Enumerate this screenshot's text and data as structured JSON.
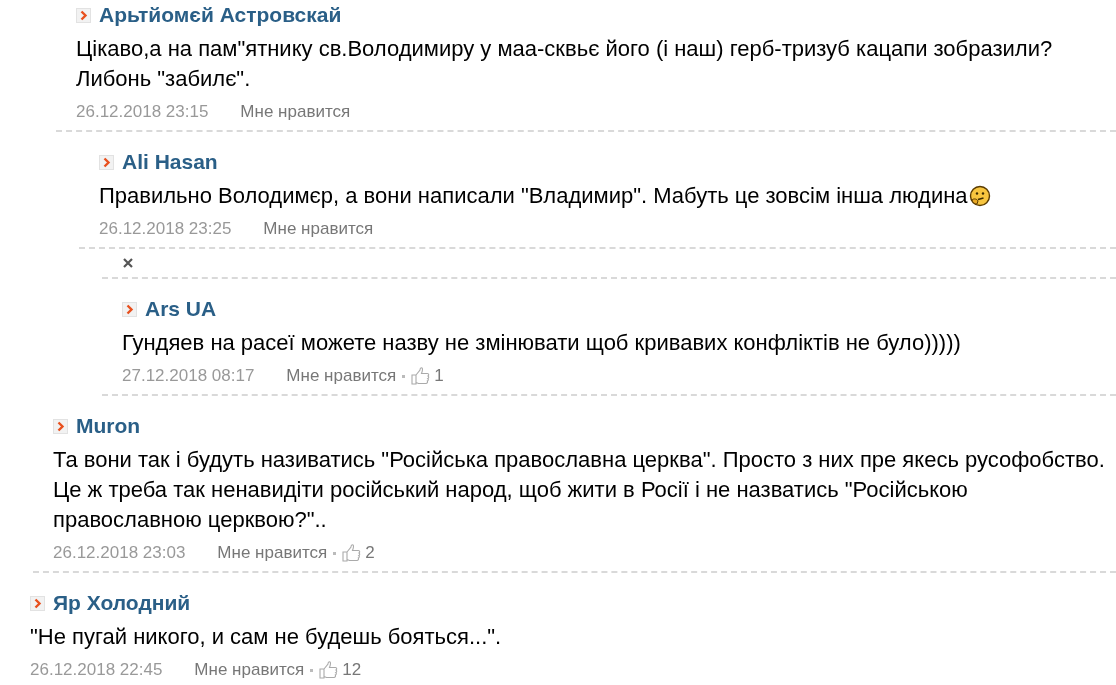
{
  "comments": [
    {
      "kind": "group",
      "children": [
        {
          "kind": "group",
          "children": [
            {
              "kind": "comment",
              "author": "Арьтйомєй Астровскай",
              "text": "Цікаво,а на пам\"ятнику св.Володимиру у маа-сквьє його (і наш) герб-тризуб кацапи зобразили? Либонь \"забилє\".",
              "date": "26.12.2018 23:15",
              "like": "Мне нравится",
              "children": [
                {
                  "kind": "comment",
                  "author": "Ali Hasan",
                  "text": "Правильно Володимєр, а вони написали \"Владимир\". Мабуть це зовсім інша людина",
                  "emoji": true,
                  "date": "26.12.2018 23:25",
                  "like": "Мне нравится",
                  "children": [
                    {
                      "kind": "close"
                    },
                    {
                      "kind": "comment",
                      "author": "Ars UA",
                      "text": "Гундяев на расеї можете назву не змінювати щоб кривавих конфліктів не було)))))",
                      "date": "27.12.2018 08:17",
                      "like": "Мне нравится",
                      "likes": "1"
                    }
                  ]
                }
              ]
            }
          ]
        },
        {
          "kind": "comment",
          "author": "Muron",
          "text": "Та вони так і будуть називатись \"Російська православна церква\". Просто з них пре якесь русофобство. Це ж треба так ненавидіти російський народ, щоб жити в Росії і не назватись \"Російською православною церквою?\"..",
          "date": "26.12.2018 23:03",
          "like": "Мне нравится",
          "likes": "2"
        }
      ]
    },
    {
      "kind": "comment",
      "author": "Яр Холодний",
      "text": "\"Не пугай никого, и сам не будешь бояться...\".",
      "date": "26.12.2018 22:45",
      "like": "Мне нравится",
      "likes": "12"
    }
  ]
}
